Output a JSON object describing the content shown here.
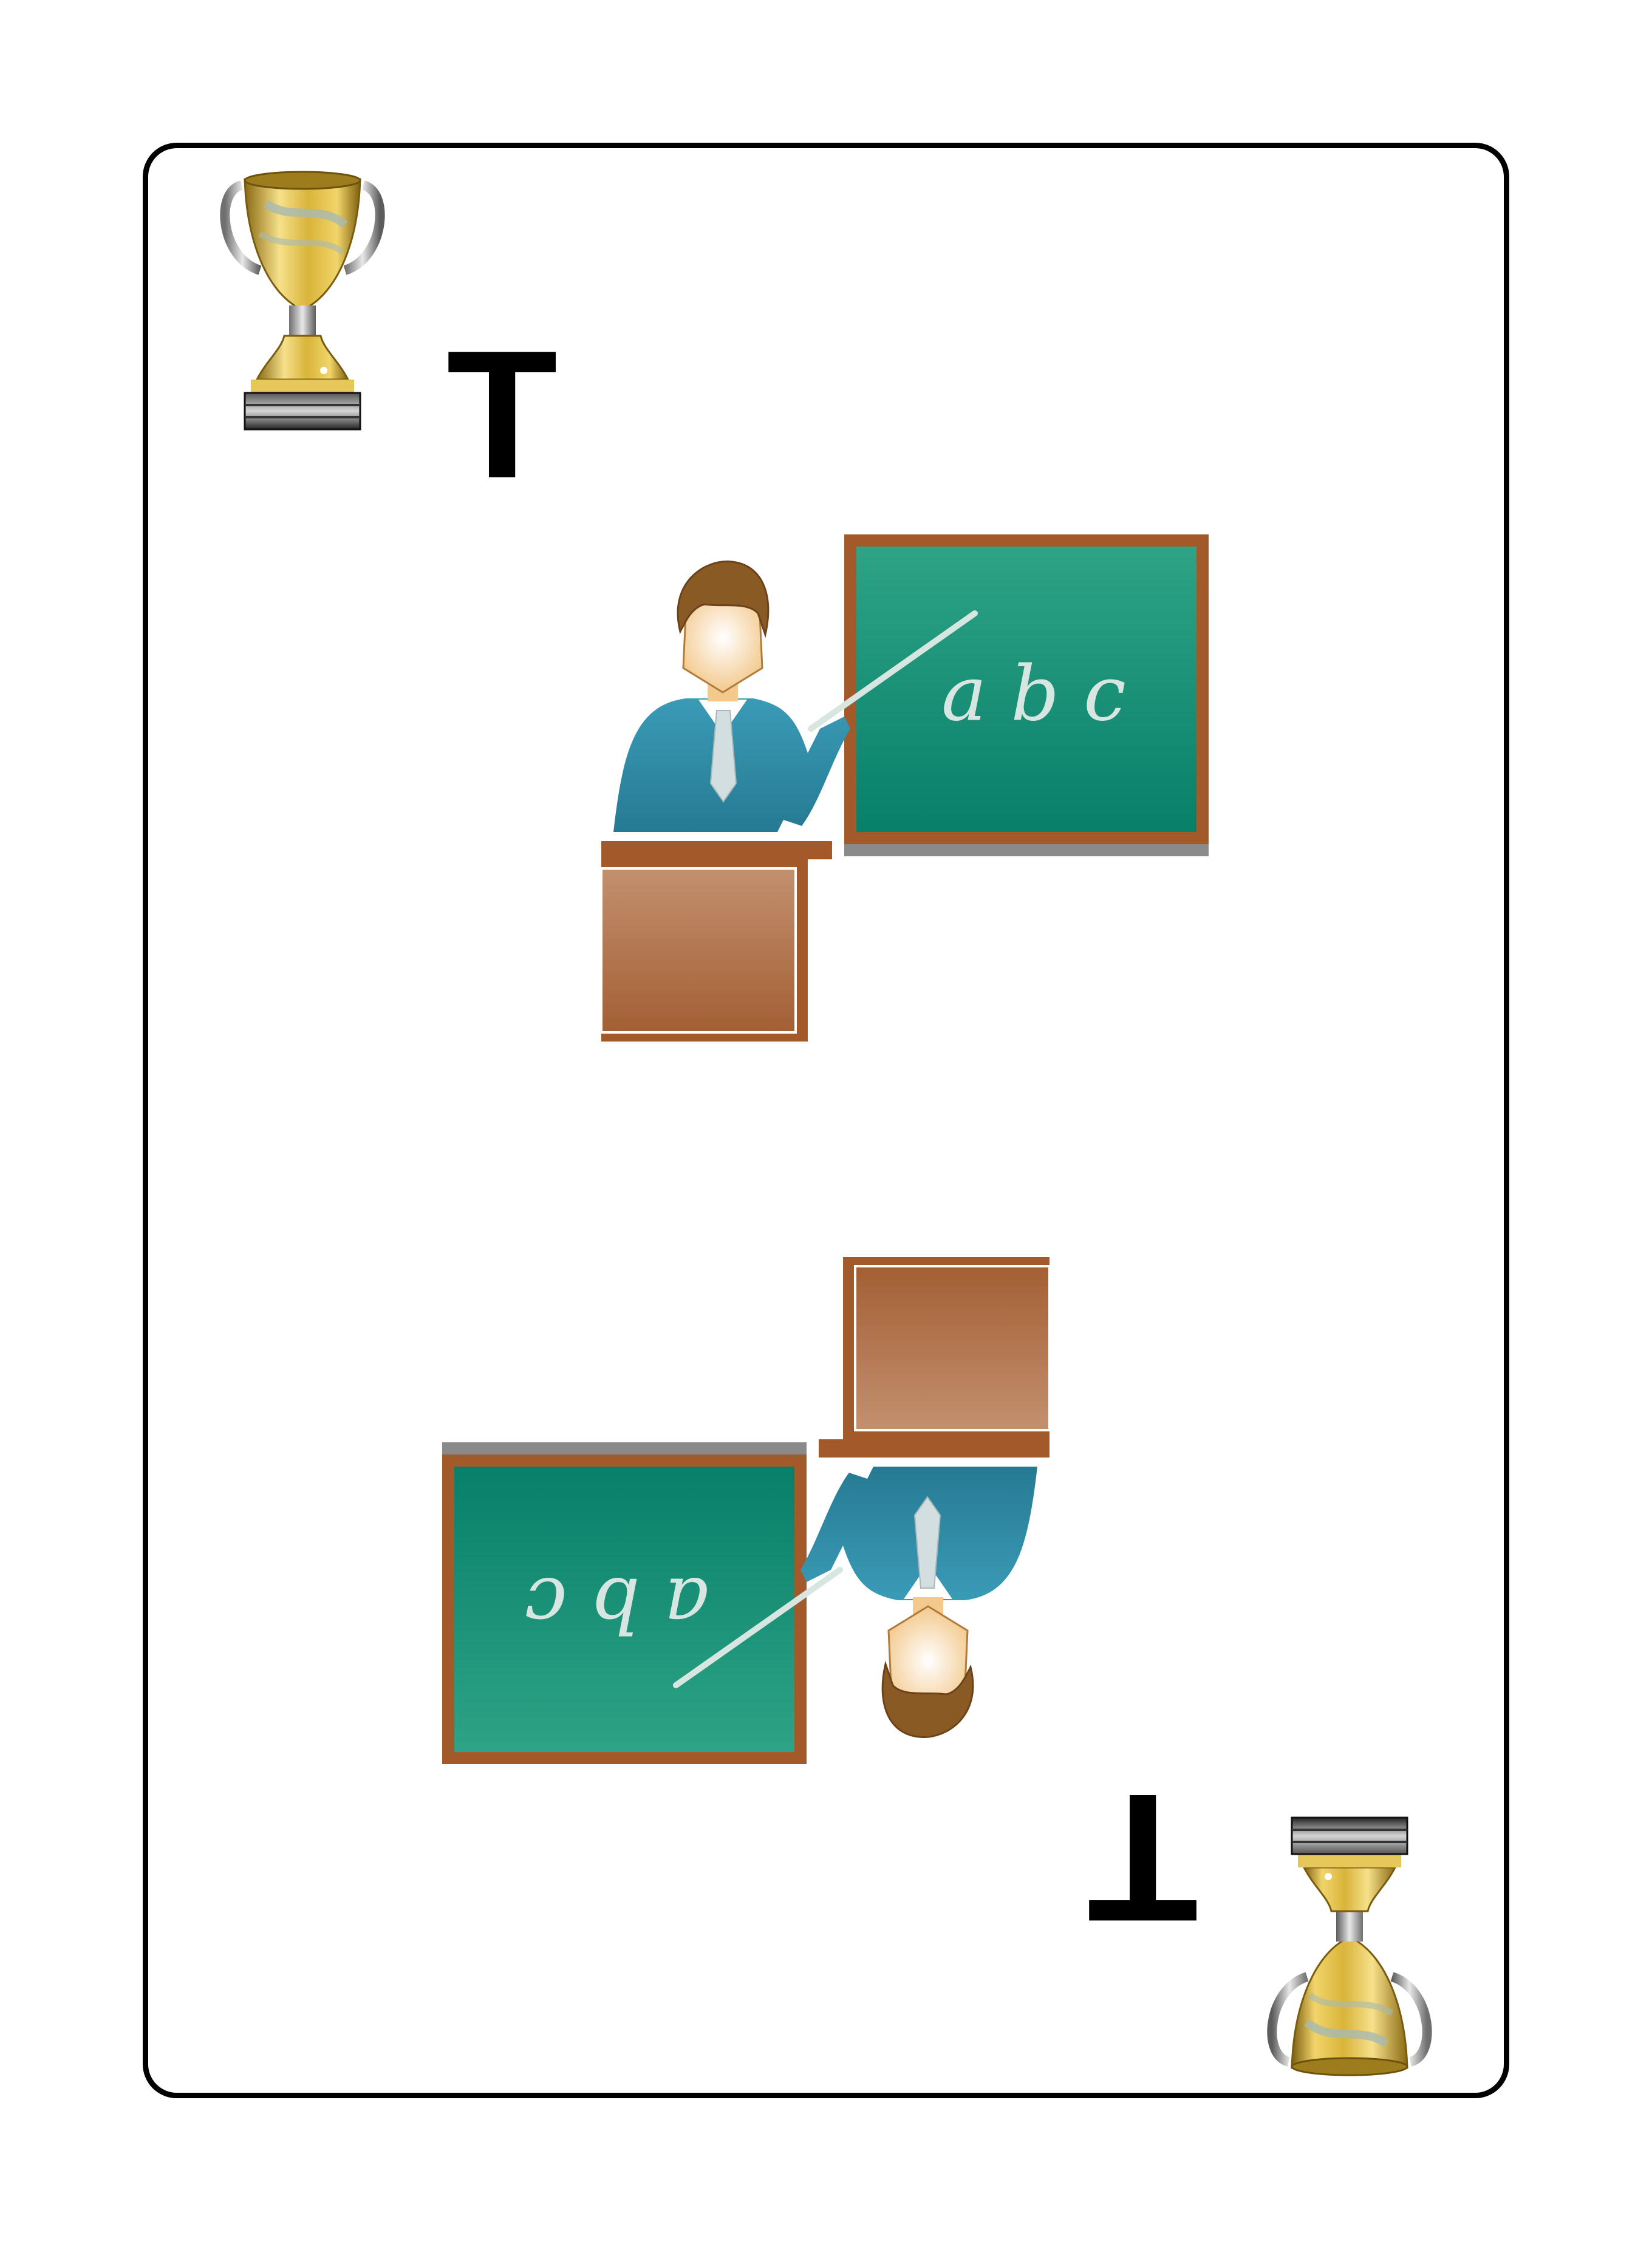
{
  "card": {
    "rank": "T",
    "suit_icon": "trophy-icon",
    "illustration": "teacher-icon",
    "chalkboard_text": "a b c"
  },
  "colors": {
    "border": "#000000",
    "chalkboard": "#138a6e",
    "board_frame": "#a35a2a",
    "desk": "#b07a55",
    "suit": "#2e86a0",
    "trophy_gold": "#d9b43a"
  }
}
